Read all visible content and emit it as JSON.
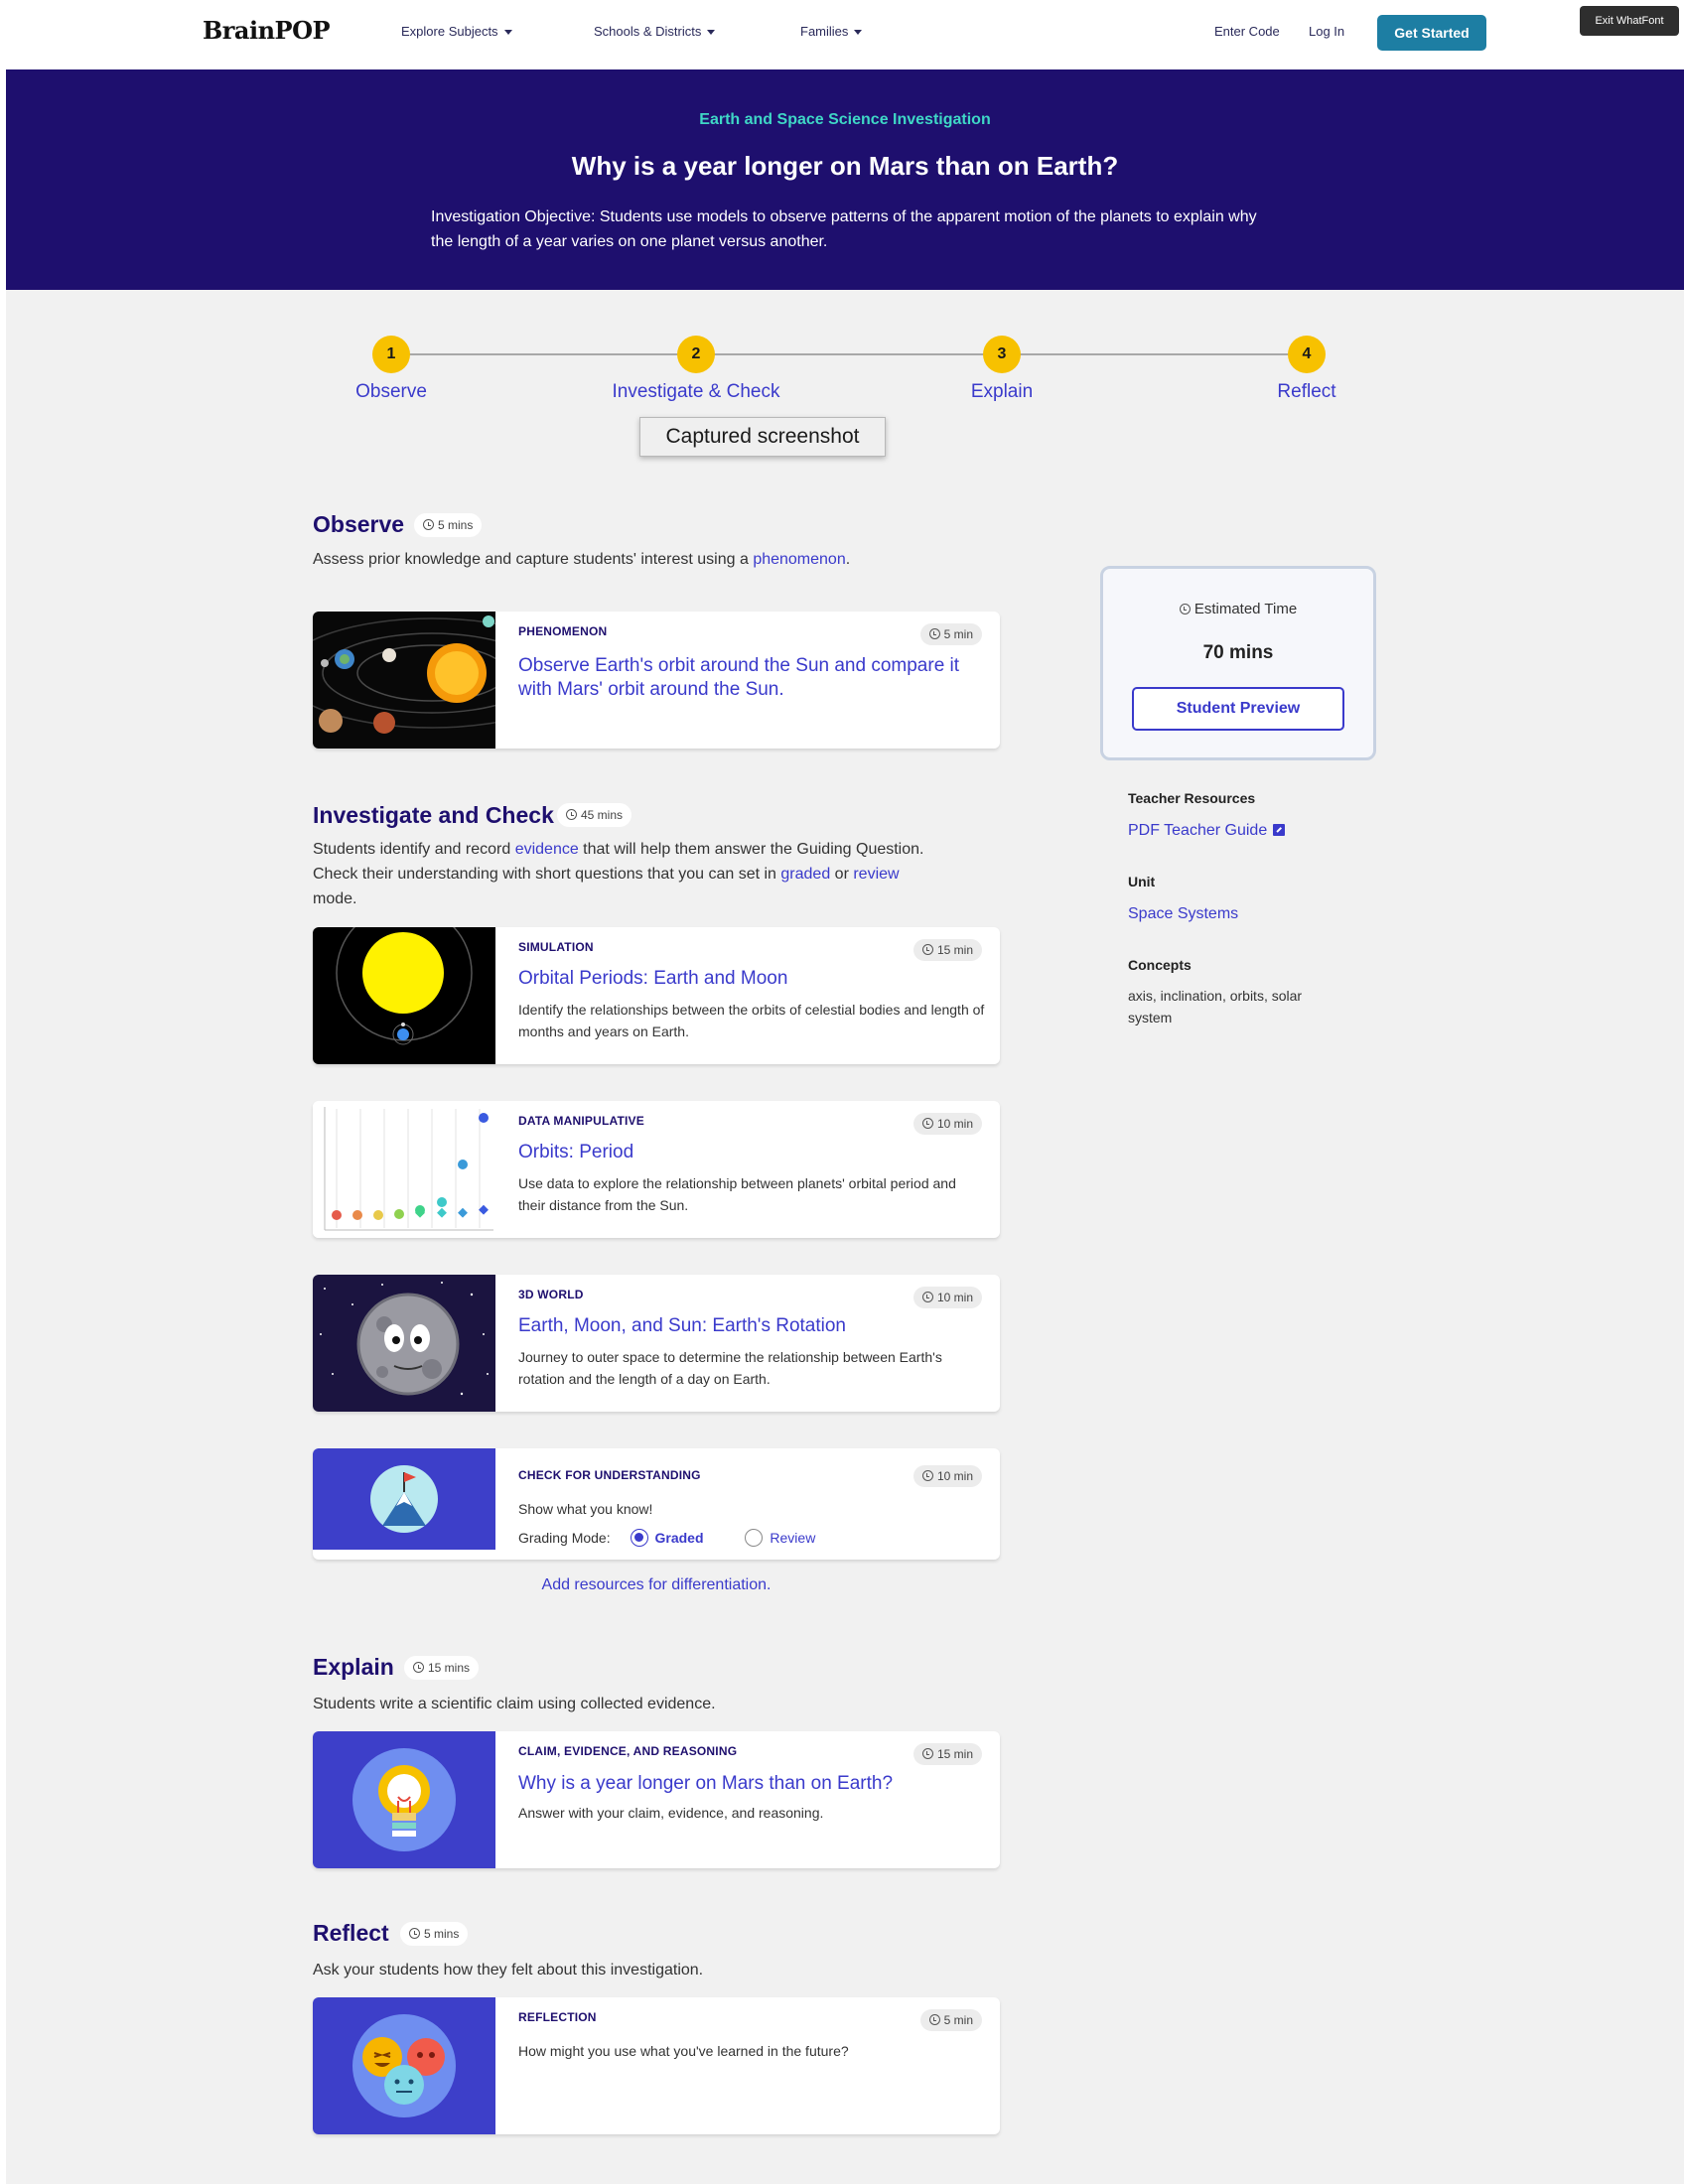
{
  "nav": {
    "logo": "BrainPOP",
    "explore_subjects": "Explore Subjects",
    "schools_districts": "Schools & Districts",
    "families": "Families",
    "enter_code": "Enter Code",
    "log_in": "Log In",
    "get_started": "Get Started",
    "exit_whatfont": "Exit WhatFont",
    "accent_color": "#1d7ea3"
  },
  "hero": {
    "kicker": "Earth and Space Science Investigation",
    "title": "Why is a year longer on Mars than on Earth?",
    "objective": "Investigation Objective: Students use models to observe patterns of the apparent motion of the planets to explain why the length of a year varies on one planet versus another.",
    "background_color": "#1e0f6e"
  },
  "stepper": {
    "steps": [
      {
        "number": "1",
        "label": "Observe"
      },
      {
        "number": "2",
        "label": "Investigate & Check"
      },
      {
        "number": "3",
        "label": "Explain"
      },
      {
        "number": "4",
        "label": "Reflect"
      }
    ],
    "dot_color": "#f7c100"
  },
  "tooltip": "Captured screenshot",
  "observe": {
    "title": "Observe",
    "time": "5 mins",
    "desc_pre": "Assess prior knowledge and capture students' interest using a ",
    "desc_link": "phenomenon",
    "desc_post": ".",
    "card": {
      "type": "PHENOMENON",
      "time": "5 min",
      "title": "Observe Earth's orbit around the Sun and compare it with Mars' orbit around the Sun."
    }
  },
  "investigate": {
    "title": "Investigate and Check",
    "time": "45 mins",
    "desc_1": "Students identify and record ",
    "desc_link_1": "evidence",
    "desc_2": " that will help them answer the Guiding Question. Check their understanding with short questions that you can set in ",
    "desc_link_2": "graded",
    "desc_3": " or ",
    "desc_link_3": "review",
    "desc_4": " mode.",
    "cards": [
      {
        "type": "SIMULATION",
        "time": "15 min",
        "title": "Orbital Periods: Earth and Moon",
        "desc": "Identify the relationships between the orbits of celestial bodies and length of months and years on Earth."
      },
      {
        "type": "DATA MANIPULATIVE",
        "time": "10 min",
        "title": "Orbits: Period",
        "desc": "Use data to explore the relationship between planets' orbital period and their distance from the Sun."
      },
      {
        "type": "3D WORLD",
        "time": "10 min",
        "title": "Earth, Moon, and Sun: Earth's Rotation",
        "desc": "Journey to outer space to determine the relationship between Earth's rotation and the length of a day on Earth."
      }
    ],
    "check": {
      "type": "CHECK FOR UNDERSTANDING",
      "time": "10 min",
      "prompt": "Show what you know!",
      "grading_label": "Grading Mode:",
      "graded": "Graded",
      "review": "Review",
      "selected": "Graded"
    },
    "add_resources": "Add resources for differentiation."
  },
  "explain": {
    "title": "Explain",
    "time": "15 mins",
    "desc": "Students write a scientific claim using collected evidence.",
    "card": {
      "type": "CLAIM, EVIDENCE, AND REASONING",
      "time": "15 min",
      "title": "Why is a year longer on Mars than on Earth?",
      "desc": "Answer with your claim, evidence, and reasoning."
    }
  },
  "reflect": {
    "title": "Reflect",
    "time": "5 mins",
    "desc": "Ask your students how they felt about this investigation.",
    "card": {
      "type": "REFLECTION",
      "time": "5 min",
      "desc": "How might you use what you've learned in the future?"
    }
  },
  "sidebar": {
    "estimated_label": "Estimated Time",
    "estimated_value": "70 mins",
    "student_preview": "Student Preview",
    "teacher_resources": "Teacher Resources",
    "pdf_guide": "PDF Teacher Guide",
    "unit_label": "Unit",
    "unit_value": "Space Systems",
    "concepts_label": "Concepts",
    "concepts_value": "axis, inclination, orbits, solar system",
    "link_color": "#3a3acb"
  }
}
